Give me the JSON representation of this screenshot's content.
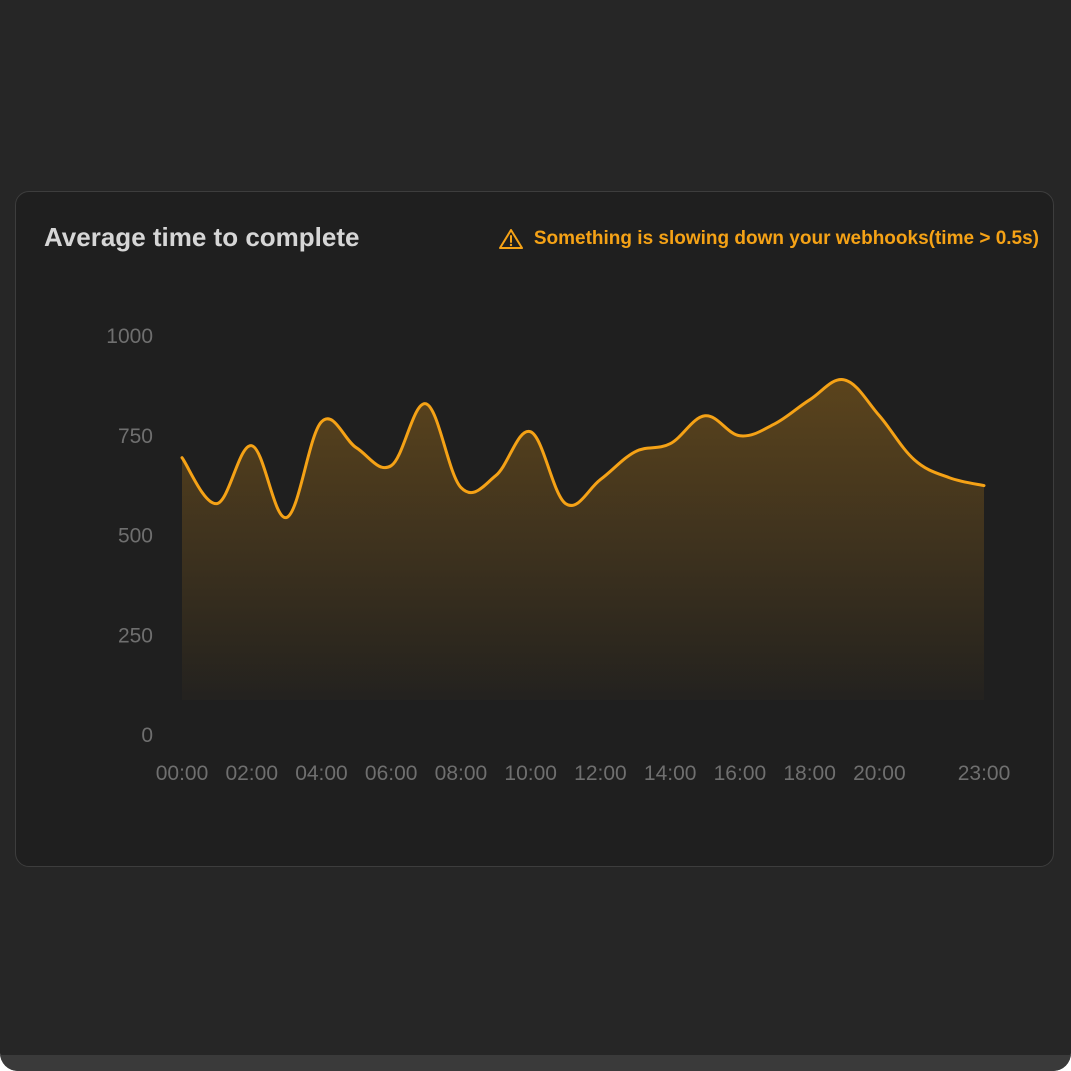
{
  "card": {
    "title": "Average time to complete",
    "warning": "Something is slowing down your webhooks(time > 0.5s)",
    "warning_icon": "warning-triangle-icon"
  },
  "colors": {
    "background": "#262626",
    "card": "#1f1f1f",
    "accent": "#f5a216",
    "title": "#d6d6d6",
    "tick": "#6f6f6f"
  },
  "chart_data": {
    "type": "area",
    "title": "Average time to complete",
    "xlabel": "",
    "ylabel": "",
    "ylim": [
      0,
      1000
    ],
    "yticks": [
      0,
      250,
      500,
      750,
      1000
    ],
    "xtick_labels": [
      "00:00",
      "02:00",
      "04:00",
      "06:00",
      "08:00",
      "10:00",
      "12:00",
      "14:00",
      "16:00",
      "18:00",
      "20:00",
      "23:00"
    ],
    "xtick_hours": [
      0,
      2,
      4,
      6,
      8,
      10,
      12,
      14,
      16,
      18,
      20,
      23
    ],
    "xlim": [
      0,
      23
    ],
    "grid": false,
    "legend": "none",
    "series": [
      {
        "x": [
          0,
          1,
          2,
          3,
          4,
          5,
          6,
          7,
          8,
          9,
          10,
          11,
          12,
          13,
          14,
          15,
          16,
          17,
          18,
          19,
          20,
          21,
          22,
          23
        ],
        "values": [
          695,
          580,
          725,
          545,
          785,
          720,
          675,
          830,
          620,
          650,
          760,
          580,
          640,
          710,
          730,
          800,
          750,
          780,
          840,
          890,
          800,
          690,
          645,
          625
        ]
      }
    ]
  }
}
